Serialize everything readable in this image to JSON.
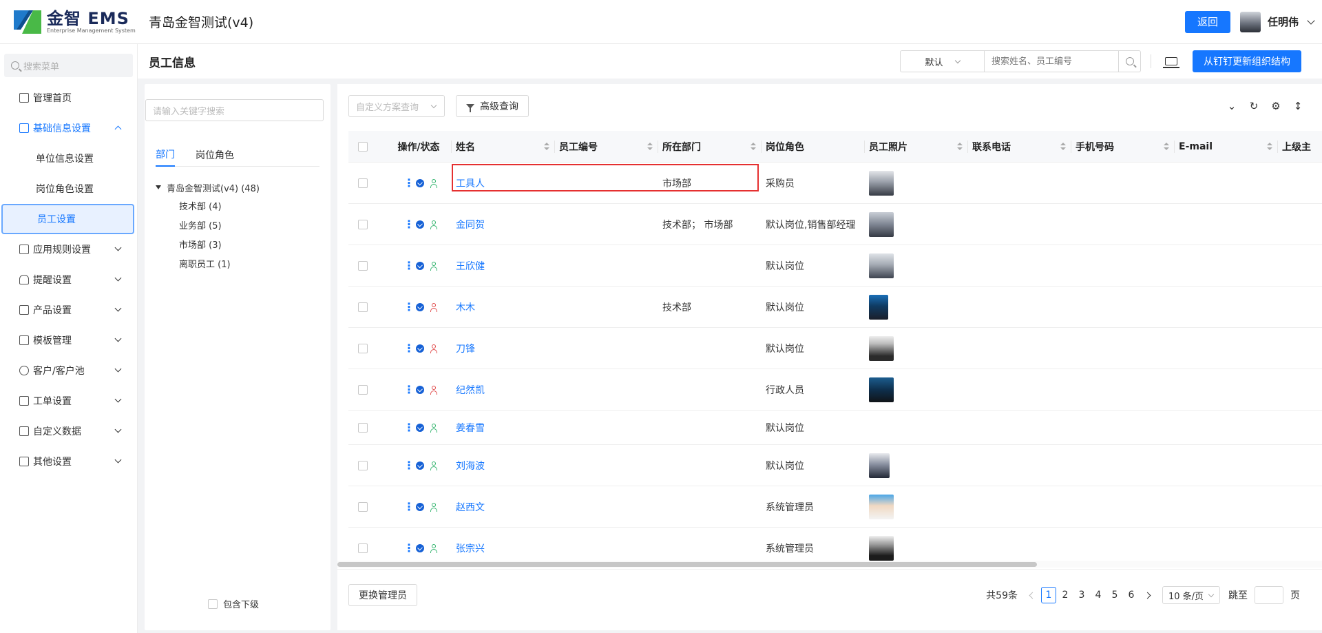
{
  "header": {
    "logo_title": "金智 EMS",
    "logo_subtitle": "Enterprise Management System",
    "app_title": "青岛金智测试(v4)",
    "back_label": "返回",
    "user_name": "任明伟"
  },
  "sidebar": {
    "search_placeholder": "搜索菜单",
    "items": [
      {
        "label": "管理首页"
      },
      {
        "label": "基础信息设置"
      },
      {
        "label": "单位信息设置"
      },
      {
        "label": "岗位角色设置"
      },
      {
        "label": "员工设置"
      },
      {
        "label": "应用规则设置"
      },
      {
        "label": "提醒设置"
      },
      {
        "label": "产品设置"
      },
      {
        "label": "模板管理"
      },
      {
        "label": "客户/客户池"
      },
      {
        "label": "工单设置"
      },
      {
        "label": "自定义数据"
      },
      {
        "label": "其他设置"
      }
    ]
  },
  "titlebar": {
    "title": "员工信息",
    "default_select": "默认",
    "search_placeholder": "搜索姓名、员工编号",
    "sync_button": "从钉钉更新组织结构"
  },
  "dept_panel": {
    "keyword_placeholder": "请输入关键字搜索",
    "tabs": [
      "部门",
      "岗位角色"
    ],
    "root": "青岛金智测试(v4) (48)",
    "nodes": [
      "技术部 (4)",
      "业务部 (5)",
      "市场部 (3)",
      "离职员工 (1)"
    ],
    "include_sub": "包含下级"
  },
  "toolbar": {
    "scheme_placeholder": "自定义方案查询",
    "advanced_query": "高级查询"
  },
  "table": {
    "columns": [
      "操作/状态",
      "姓名",
      "员工编号",
      "所在部门",
      "岗位角色",
      "员工照片",
      "联系电话",
      "手机号码",
      "E-mail",
      "上级主"
    ],
    "rows": [
      {
        "name": "工具人",
        "dept": "市场部",
        "role": "采购员",
        "person_status": "green"
      },
      {
        "name": "金同贺",
        "dept": "技术部； 市场部",
        "role": "默认岗位,销售部经理",
        "person_status": "green"
      },
      {
        "name": "王欣健",
        "dept": "",
        "role": "默认岗位",
        "person_status": "green"
      },
      {
        "name": "木木",
        "dept": "技术部",
        "role": "默认岗位",
        "person_status": "red"
      },
      {
        "name": "刀锋",
        "dept": "",
        "role": "默认岗位",
        "person_status": "red"
      },
      {
        "name": "纪然凯",
        "dept": "",
        "role": "行政人员",
        "person_status": "red"
      },
      {
        "name": "姜春雪",
        "dept": "",
        "role": "默认岗位",
        "person_status": "green"
      },
      {
        "name": "刘海波",
        "dept": "",
        "role": "默认岗位",
        "person_status": "green"
      },
      {
        "name": "赵西文",
        "dept": "",
        "role": "系统管理员",
        "person_status": "green"
      },
      {
        "name": "张宗兴",
        "dept": "",
        "role": "系统管理员",
        "person_status": "green"
      }
    ]
  },
  "footer": {
    "swap_admin": "更换管理员",
    "total": "共59条",
    "pages": [
      "1",
      "2",
      "3",
      "4",
      "5",
      "6"
    ],
    "current_page": "1",
    "page_size": "10 条/页",
    "jump_to": "跳至",
    "page_unit": "页"
  },
  "colors": {
    "primary": "#1677ff",
    "status_green": "#2fb36b",
    "status_red": "#e04848",
    "highlight_red": "#e53030"
  }
}
